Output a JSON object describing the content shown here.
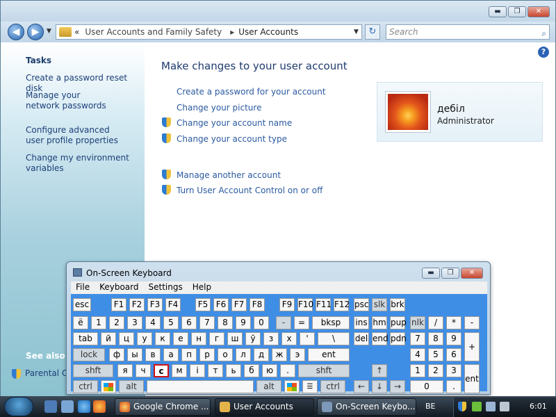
{
  "window": {
    "minimize": "▬",
    "maximize": "❐",
    "close": "✕"
  },
  "nav": {
    "back": "◀",
    "forward": "▶",
    "path_sep": "«",
    "crumb1": "User Accounts and Family Safety",
    "crumb_sep": "▸",
    "crumb2": "User Accounts",
    "dropdown": "▼",
    "refresh": "↻",
    "search_placeholder": "Search",
    "search_icon": "⌕"
  },
  "sidebar": {
    "tasks_heading": "Tasks",
    "items": [
      "Create a password reset disk",
      "Manage your network passwords",
      "Configure advanced user profile properties",
      "Change my environment variables"
    ],
    "see_also": "See also",
    "parental": "Parental Co"
  },
  "main": {
    "help": "?",
    "heading": "Make changes to your user account",
    "links": [
      "Create a password for your account",
      "Change your picture",
      "Change your account name",
      "Change your account type",
      "Manage another account",
      "Turn User Account Control on or off"
    ]
  },
  "account": {
    "name": "дебіл",
    "role": "Administrator"
  },
  "osk": {
    "title": "On-Screen Keyboard",
    "menu": [
      "File",
      "Keyboard",
      "Settings",
      "Help"
    ],
    "keys": {
      "esc": "esc",
      "f1": "F1",
      "f2": "F2",
      "f3": "F3",
      "f4": "F4",
      "f5": "F5",
      "f6": "F6",
      "f7": "F7",
      "f8": "F8",
      "f9": "F9",
      "f10": "F10",
      "f11": "F11",
      "f12": "F12",
      "psc": "psc",
      "slk": "slk",
      "brk": "brk",
      "r1": [
        "ё",
        "1",
        "2",
        "3",
        "4",
        "5",
        "6",
        "7",
        "8",
        "9",
        "0",
        "-",
        "="
      ],
      "bksp": "bksp",
      "ins": "ins",
      "hm": "hm",
      "pup": "pup",
      "nlk": "nlk",
      "ndiv": "/",
      "nmul": "*",
      "nsub": "-",
      "tab": "tab",
      "r2": [
        "й",
        "ц",
        "у",
        "к",
        "е",
        "н",
        "г",
        "ш",
        "ў",
        "з",
        "х",
        "'",
        "\\"
      ],
      "del": "del",
      "end": "end",
      "pdn": "pdn",
      "n7": "7",
      "n8": "8",
      "n9": "9",
      "nadd": "+",
      "lock": "lock",
      "r3": [
        "ф",
        "ы",
        "в",
        "а",
        "п",
        "р",
        "о",
        "л",
        "д",
        "ж",
        "э"
      ],
      "ent": "ent",
      "n4": "4",
      "n5": "5",
      "n6": "6",
      "shft": "shft",
      "r4": [
        "я",
        "ч",
        "с",
        "м",
        "і",
        "т",
        "ь",
        "б",
        "ю",
        "."
      ],
      "up": "↑",
      "n1": "1",
      "n2": "2",
      "n3": "3",
      "nent": "ent",
      "ctrl": "ctrl",
      "alt": "alt",
      "left": "←",
      "down": "↓",
      "right": "→",
      "n0": "0",
      "ndot": "."
    }
  },
  "taskbar": {
    "items": [
      "Google Chrome ...",
      "User Accounts",
      "On-Screen Keybo..."
    ],
    "lang": "BE",
    "clock": "6:01"
  }
}
